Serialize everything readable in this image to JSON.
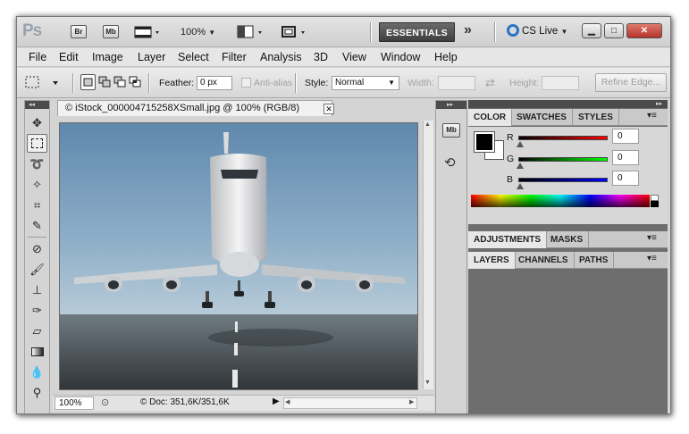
{
  "appbar": {
    "logo": "Ps",
    "bridge": "Br",
    "mini_bridge": "Mb",
    "zoom": "100%",
    "workspace": "ESSENTIALS",
    "cs_live": "CS Live"
  },
  "menus": [
    "File",
    "Edit",
    "Image",
    "Layer",
    "Select",
    "Filter",
    "Analysis",
    "3D",
    "View",
    "Window",
    "Help"
  ],
  "options": {
    "feather_label": "Feather:",
    "feather_value": "0 px",
    "antialias_label": "Anti-alias",
    "style_label": "Style:",
    "style_value": "Normal",
    "width_label": "Width:",
    "height_label": "Height:",
    "refine_edge": "Refine Edge..."
  },
  "document": {
    "tab_title": "© iStock_000004715258XSmall.jpg @ 100% (RGB/8)",
    "zoom": "100%",
    "doc_size": "© Doc: 351,6K/351,6K"
  },
  "dock": {
    "mini_bridge": "Mb"
  },
  "panels": {
    "color_tabs": [
      "COLOR",
      "SWATCHES",
      "STYLES"
    ],
    "adjust_tabs": [
      "ADJUSTMENTS",
      "MASKS"
    ],
    "layer_tabs": [
      "LAYERS",
      "CHANNELS",
      "PATHS"
    ],
    "channels": [
      {
        "label": "R",
        "value": "0",
        "color": "#cc0000"
      },
      {
        "label": "G",
        "value": "0",
        "color": "#00aa00"
      },
      {
        "label": "B",
        "value": "0",
        "color": "#0000cc"
      }
    ]
  },
  "colors": {
    "foreground": "#000000",
    "background": "#ffffff",
    "accent": "#2a73c4"
  }
}
